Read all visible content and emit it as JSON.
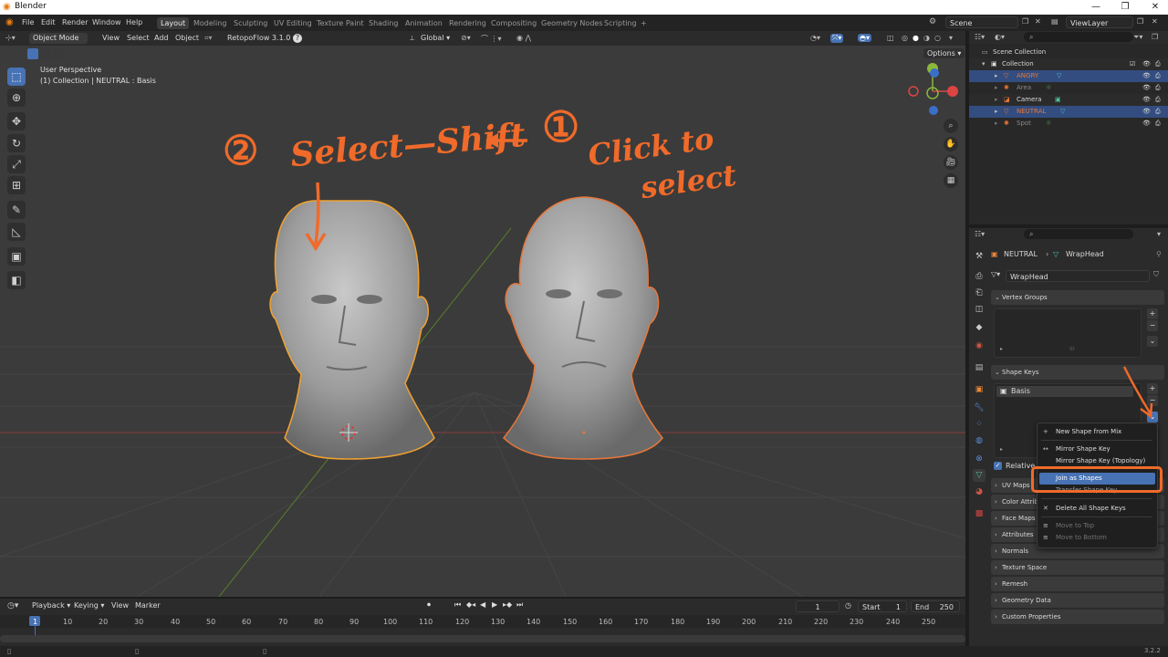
{
  "window": {
    "title": "Blender"
  },
  "menubar": {
    "items": [
      "File",
      "Edit",
      "Render",
      "Window",
      "Help"
    ]
  },
  "workspaces": {
    "tabs": [
      "Layout",
      "Modeling",
      "Sculpting",
      "UV Editing",
      "Texture Paint",
      "Shading",
      "Animation",
      "Rendering",
      "Compositing",
      "Geometry Nodes",
      "Scripting"
    ],
    "active": "Layout",
    "add": "+"
  },
  "scene": {
    "label": "Scene",
    "view_layer": "ViewLayer"
  },
  "viewport_header": {
    "mode": "Object Mode",
    "view": "View",
    "select": "Select",
    "add": "Add",
    "object": "Object",
    "addon": "RetopoFlow 3.1.0",
    "help": "?",
    "orientation": "Global",
    "options": "Options"
  },
  "viewport": {
    "perspective": "User Perspective",
    "context": "(1) Collection | NEUTRAL : Basis"
  },
  "annotations": {
    "step2": "②",
    "select_shift": "Select—Shift",
    "step1": "①",
    "click_to": "Click to",
    "select": "select"
  },
  "outliner": {
    "root": "Scene Collection",
    "collection": "Collection",
    "items": [
      {
        "name": "ANGRY",
        "color": "#e8773a",
        "selected": true
      },
      {
        "name": "Area",
        "color": "#8a8a8a",
        "selected": false
      },
      {
        "name": "Camera",
        "color": "#d6d6d6",
        "selected": false
      },
      {
        "name": "NEUTRAL",
        "color": "#e8773a",
        "selected": true
      },
      {
        "name": "Spot",
        "color": "#8a8a8a",
        "selected": false
      }
    ]
  },
  "properties": {
    "object": "NEUTRAL",
    "mesh": "WrapHead",
    "data_name": "WrapHead",
    "vertex_groups": "Vertex Groups",
    "shape_keys": "Shape Keys",
    "shape_key_item": "Basis",
    "relative": "Relative",
    "panels": [
      "UV Maps",
      "Color Attrib",
      "Face Maps",
      "Attributes",
      "Normals",
      "Texture Space",
      "Remesh",
      "Geometry Data",
      "Custom Properties"
    ]
  },
  "context_menu": {
    "items": [
      {
        "icon": "+",
        "label": "New Shape from Mix",
        "disabled": false
      },
      {
        "icon": "↔",
        "label": "Mirror Shape Key",
        "disabled": false
      },
      {
        "icon": "",
        "label": "Mirror Shape Key (Topology)",
        "disabled": false
      },
      {
        "icon": "",
        "label": "Join as Shapes",
        "disabled": false,
        "highlighted": true
      },
      {
        "icon": "",
        "label": "Transfer Shape Key",
        "disabled": false
      },
      {
        "icon": "✕",
        "label": "Delete All Shape Keys",
        "disabled": false
      },
      {
        "icon": "≡",
        "label": "Move to Top",
        "disabled": true
      },
      {
        "icon": "≡",
        "label": "Move to Bottom",
        "disabled": true
      }
    ]
  },
  "timeline": {
    "playback": "Playback",
    "keying": "Keying",
    "view": "View",
    "marker": "Marker",
    "current_frame": "1",
    "start_label": "Start",
    "start": "1",
    "end_label": "End",
    "end": "250",
    "frames": [
      "1",
      "10",
      "20",
      "30",
      "40",
      "50",
      "60",
      "70",
      "80",
      "90",
      "100",
      "110",
      "120",
      "130",
      "140",
      "150",
      "160",
      "170",
      "180",
      "190",
      "200",
      "210",
      "220",
      "230",
      "240",
      "250"
    ]
  },
  "statusbar": {
    "version": "3.2.2"
  },
  "colors": {
    "accent": "#4772b3",
    "selection_outline": "#f08a2b",
    "annotation": "#f06a2a"
  }
}
